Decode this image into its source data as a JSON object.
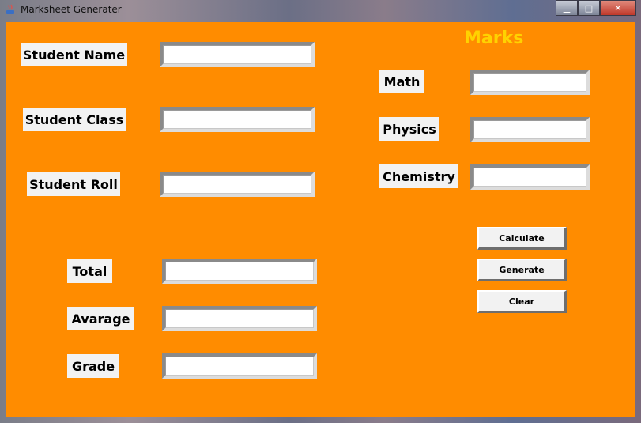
{
  "window": {
    "title": "Marksheet Generater",
    "controls": {
      "minimize": "▁",
      "maximize": "□",
      "close": "✕"
    }
  },
  "student": {
    "name_label": "Student Name",
    "class_label": "Student Class",
    "roll_label": "Student Roll",
    "name_value": "",
    "class_value": "",
    "roll_value": ""
  },
  "marks": {
    "heading": "Marks",
    "math_label": "Math",
    "physics_label": "Physics",
    "chemistry_label": "Chemistry",
    "math_value": "",
    "physics_value": "",
    "chemistry_value": ""
  },
  "results": {
    "total_label": "Total",
    "average_label": "Avarage",
    "grade_label": "Grade",
    "total_value": "",
    "average_value": "",
    "grade_value": ""
  },
  "buttons": {
    "calculate": "Calculate",
    "generate": "Generate",
    "clear": "Clear"
  },
  "colors": {
    "client_background": "#ff8c00",
    "heading": "#ffd200",
    "label_background": "#f2f2f2"
  }
}
